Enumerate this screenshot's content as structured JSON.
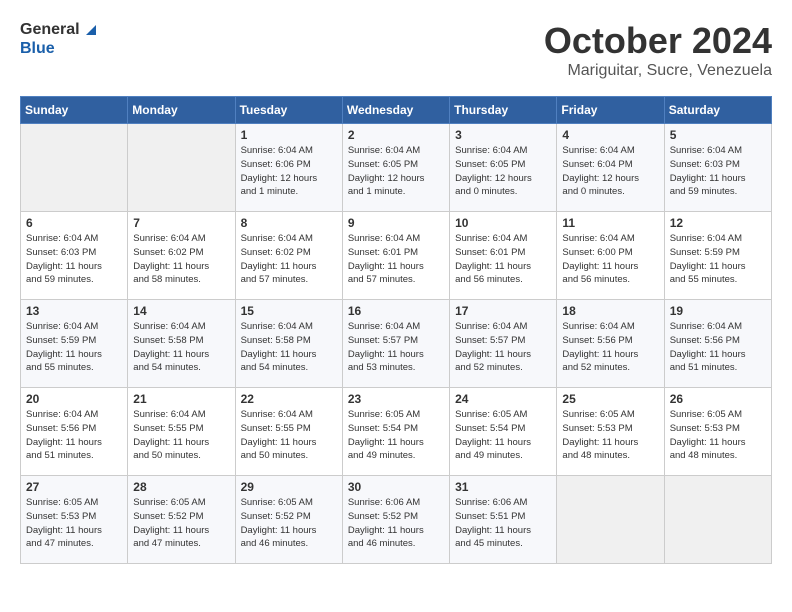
{
  "logo": {
    "line1": "General",
    "line2": "Blue"
  },
  "title": "October 2024",
  "subtitle": "Mariguitar, Sucre, Venezuela",
  "days_header": [
    "Sunday",
    "Monday",
    "Tuesday",
    "Wednesday",
    "Thursday",
    "Friday",
    "Saturday"
  ],
  "weeks": [
    [
      {
        "day": "",
        "info": ""
      },
      {
        "day": "",
        "info": ""
      },
      {
        "day": "1",
        "info": "Sunrise: 6:04 AM\nSunset: 6:06 PM\nDaylight: 12 hours\nand 1 minute."
      },
      {
        "day": "2",
        "info": "Sunrise: 6:04 AM\nSunset: 6:05 PM\nDaylight: 12 hours\nand 1 minute."
      },
      {
        "day": "3",
        "info": "Sunrise: 6:04 AM\nSunset: 6:05 PM\nDaylight: 12 hours\nand 0 minutes."
      },
      {
        "day": "4",
        "info": "Sunrise: 6:04 AM\nSunset: 6:04 PM\nDaylight: 12 hours\nand 0 minutes."
      },
      {
        "day": "5",
        "info": "Sunrise: 6:04 AM\nSunset: 6:03 PM\nDaylight: 11 hours\nand 59 minutes."
      }
    ],
    [
      {
        "day": "6",
        "info": "Sunrise: 6:04 AM\nSunset: 6:03 PM\nDaylight: 11 hours\nand 59 minutes."
      },
      {
        "day": "7",
        "info": "Sunrise: 6:04 AM\nSunset: 6:02 PM\nDaylight: 11 hours\nand 58 minutes."
      },
      {
        "day": "8",
        "info": "Sunrise: 6:04 AM\nSunset: 6:02 PM\nDaylight: 11 hours\nand 57 minutes."
      },
      {
        "day": "9",
        "info": "Sunrise: 6:04 AM\nSunset: 6:01 PM\nDaylight: 11 hours\nand 57 minutes."
      },
      {
        "day": "10",
        "info": "Sunrise: 6:04 AM\nSunset: 6:01 PM\nDaylight: 11 hours\nand 56 minutes."
      },
      {
        "day": "11",
        "info": "Sunrise: 6:04 AM\nSunset: 6:00 PM\nDaylight: 11 hours\nand 56 minutes."
      },
      {
        "day": "12",
        "info": "Sunrise: 6:04 AM\nSunset: 5:59 PM\nDaylight: 11 hours\nand 55 minutes."
      }
    ],
    [
      {
        "day": "13",
        "info": "Sunrise: 6:04 AM\nSunset: 5:59 PM\nDaylight: 11 hours\nand 55 minutes."
      },
      {
        "day": "14",
        "info": "Sunrise: 6:04 AM\nSunset: 5:58 PM\nDaylight: 11 hours\nand 54 minutes."
      },
      {
        "day": "15",
        "info": "Sunrise: 6:04 AM\nSunset: 5:58 PM\nDaylight: 11 hours\nand 54 minutes."
      },
      {
        "day": "16",
        "info": "Sunrise: 6:04 AM\nSunset: 5:57 PM\nDaylight: 11 hours\nand 53 minutes."
      },
      {
        "day": "17",
        "info": "Sunrise: 6:04 AM\nSunset: 5:57 PM\nDaylight: 11 hours\nand 52 minutes."
      },
      {
        "day": "18",
        "info": "Sunrise: 6:04 AM\nSunset: 5:56 PM\nDaylight: 11 hours\nand 52 minutes."
      },
      {
        "day": "19",
        "info": "Sunrise: 6:04 AM\nSunset: 5:56 PM\nDaylight: 11 hours\nand 51 minutes."
      }
    ],
    [
      {
        "day": "20",
        "info": "Sunrise: 6:04 AM\nSunset: 5:56 PM\nDaylight: 11 hours\nand 51 minutes."
      },
      {
        "day": "21",
        "info": "Sunrise: 6:04 AM\nSunset: 5:55 PM\nDaylight: 11 hours\nand 50 minutes."
      },
      {
        "day": "22",
        "info": "Sunrise: 6:04 AM\nSunset: 5:55 PM\nDaylight: 11 hours\nand 50 minutes."
      },
      {
        "day": "23",
        "info": "Sunrise: 6:05 AM\nSunset: 5:54 PM\nDaylight: 11 hours\nand 49 minutes."
      },
      {
        "day": "24",
        "info": "Sunrise: 6:05 AM\nSunset: 5:54 PM\nDaylight: 11 hours\nand 49 minutes."
      },
      {
        "day": "25",
        "info": "Sunrise: 6:05 AM\nSunset: 5:53 PM\nDaylight: 11 hours\nand 48 minutes."
      },
      {
        "day": "26",
        "info": "Sunrise: 6:05 AM\nSunset: 5:53 PM\nDaylight: 11 hours\nand 48 minutes."
      }
    ],
    [
      {
        "day": "27",
        "info": "Sunrise: 6:05 AM\nSunset: 5:53 PM\nDaylight: 11 hours\nand 47 minutes."
      },
      {
        "day": "28",
        "info": "Sunrise: 6:05 AM\nSunset: 5:52 PM\nDaylight: 11 hours\nand 47 minutes."
      },
      {
        "day": "29",
        "info": "Sunrise: 6:05 AM\nSunset: 5:52 PM\nDaylight: 11 hours\nand 46 minutes."
      },
      {
        "day": "30",
        "info": "Sunrise: 6:06 AM\nSunset: 5:52 PM\nDaylight: 11 hours\nand 46 minutes."
      },
      {
        "day": "31",
        "info": "Sunrise: 6:06 AM\nSunset: 5:51 PM\nDaylight: 11 hours\nand 45 minutes."
      },
      {
        "day": "",
        "info": ""
      },
      {
        "day": "",
        "info": ""
      }
    ]
  ]
}
